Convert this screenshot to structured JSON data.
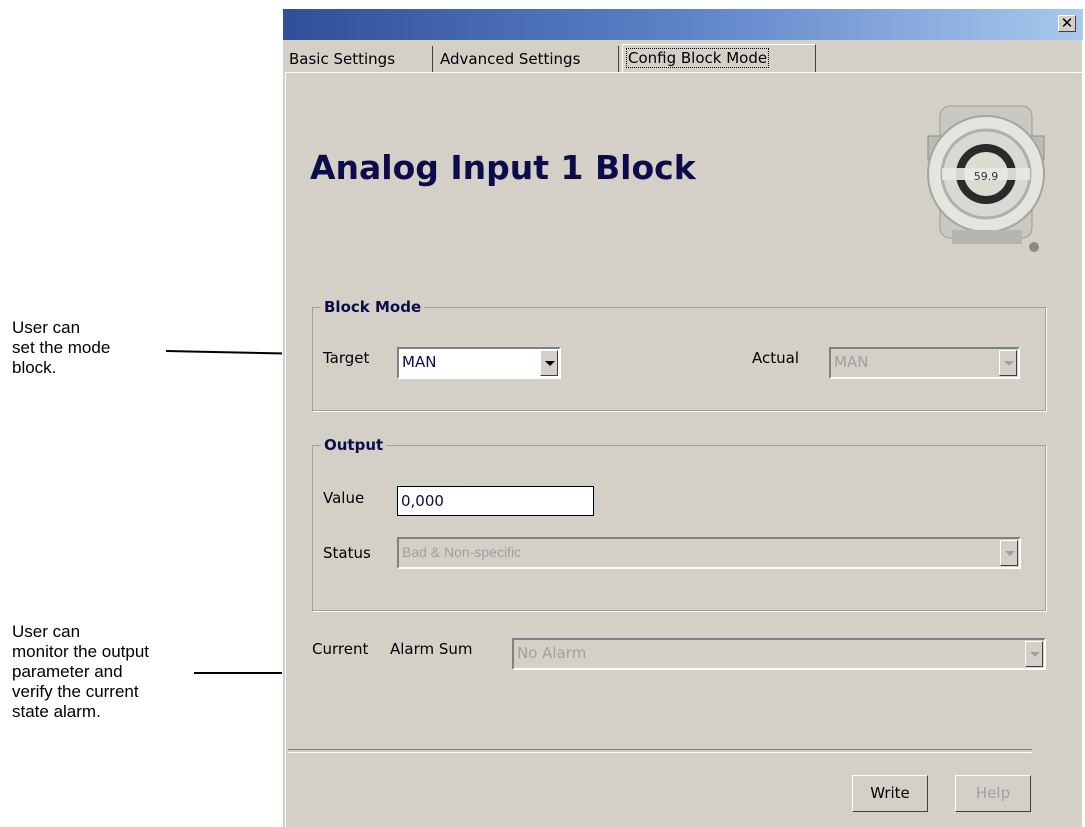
{
  "annotations": {
    "mode_note": [
      "User can",
      "set the mode",
      "block."
    ],
    "monitor_note": [
      "User can",
      "monitor the output",
      "parameter and",
      "verify the current",
      "state alarm."
    ]
  },
  "window": {
    "close_glyph": "✕",
    "tabs": [
      "Basic Settings",
      "Advanced Settings",
      "Config Block Mode"
    ],
    "active_tab": "Config Block Mode",
    "heading": "Analog Input 1 Block",
    "device_display": "59.9",
    "block_mode": {
      "title": "Block Mode",
      "target_label": "Target",
      "target_value": "MAN",
      "actual_label": "Actual",
      "actual_value": "MAN"
    },
    "output": {
      "title": "Output",
      "value_label": "Value",
      "value": "0,000",
      "status_label": "Status",
      "status_value": "Bad & Non-specific"
    },
    "alarm": {
      "label_current": "Current",
      "label_alarm_sum": "Alarm Sum",
      "value": "No Alarm"
    },
    "buttons": {
      "write": "Write",
      "help": "Help"
    }
  },
  "colors": {
    "heading": "#0c0c4a",
    "face": "#d4d0c8",
    "titlebar_start": "#2f4f99",
    "titlebar_end": "#a9c8ee"
  }
}
